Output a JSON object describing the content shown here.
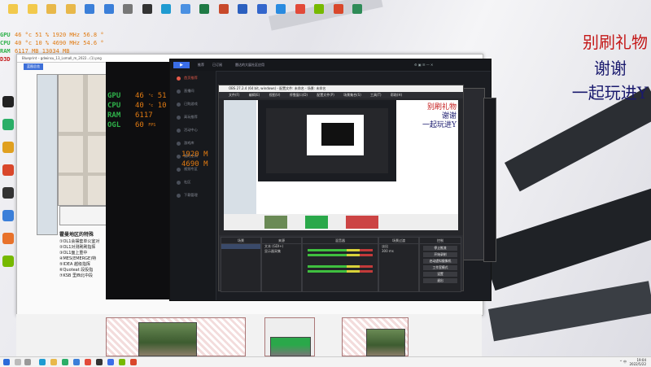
{
  "desktop": {
    "icons": [
      {
        "label": "",
        "icon": "file-icon",
        "color": "#f2c94c"
      },
      {
        "label": "",
        "icon": "file-icon",
        "color": "#f2c94c"
      },
      {
        "label": "",
        "icon": "folder-icon",
        "color": "#e8b84a"
      },
      {
        "label": "",
        "icon": "folder-icon",
        "color": "#e8b84a"
      },
      {
        "label": "",
        "icon": "app-icon",
        "color": "#3b7fd9"
      },
      {
        "label": "",
        "icon": "app-icon",
        "color": "#3b7fd9"
      },
      {
        "label": "",
        "icon": "app-icon",
        "color": "#777777"
      },
      {
        "label": "",
        "icon": "mouse-icon",
        "color": "#333333"
      },
      {
        "label": "",
        "icon": "edge-icon",
        "color": "#1f9bd1"
      },
      {
        "label": "",
        "icon": "app-icon",
        "color": "#4a90e2"
      },
      {
        "label": "",
        "icon": "excel-icon",
        "color": "#1f7a45"
      },
      {
        "label": "",
        "icon": "powerpoint-icon",
        "color": "#c8492b"
      },
      {
        "label": "",
        "icon": "word-icon",
        "color": "#2b5fbf"
      },
      {
        "label": "",
        "icon": "app-icon",
        "color": "#3366cc"
      },
      {
        "label": "",
        "icon": "shield-icon",
        "color": "#2a8be0"
      },
      {
        "label": "",
        "icon": "chrome-icon",
        "color": "#e24a3a"
      },
      {
        "label": "",
        "icon": "nvidia-icon",
        "color": "#76b900"
      },
      {
        "label": "",
        "icon": "app-icon",
        "color": "#d9472b"
      },
      {
        "label": "",
        "icon": "xbox-icon",
        "color": "#2e8b57"
      }
    ],
    "left_icons": [
      {
        "icon": "qq-icon",
        "color": "#222222"
      },
      {
        "icon": "wechat-icon",
        "color": "#2aae67"
      },
      {
        "icon": "app-icon",
        "color": "#e0a020"
      },
      {
        "icon": "app-icon",
        "color": "#d9472b"
      },
      {
        "icon": "app-icon",
        "color": "#333333"
      },
      {
        "icon": "app-icon",
        "color": "#3b7fd9"
      },
      {
        "icon": "app-icon",
        "color": "#e8722b"
      },
      {
        "icon": "app-icon",
        "color": "#76b900"
      }
    ],
    "banner_text": [
      "别刷礼物",
      "谢谢",
      "一起玩进Y"
    ],
    "osd_small": [
      {
        "key": "GPU",
        "value": "46 °c   51 %  1920 MHz  56.8 °"
      },
      {
        "key": "CPU",
        "value": "40 °c   10 %  4690 MHz  54.6 °"
      },
      {
        "key": "RAM",
        "value": "6117 MB   13034 MB"
      },
      {
        "key": "D3D",
        "value": ""
      }
    ]
  },
  "blueprint_window": {
    "title": "Blueprint – gdwinsu_13_Lsmall_m_2022...(1).png",
    "tab": "蓝图总览",
    "legend_title": "霍曼地区的特殊",
    "legend_items": [
      "①OL1会摆套单公室对",
      "②OL1对测刷刷指挥",
      "③OL1面上重中",
      "④MES(EMERGE)特",
      "⑤IDEA 越级指挥",
      "⑥Quoteat 段投指",
      "⑦KSB 里西北中段"
    ]
  },
  "metrics_overlay": {
    "rows": [
      {
        "key": "GPU",
        "value": "46",
        "unit": "°c",
        "v2": "51",
        "u2": "%"
      },
      {
        "key": "CPU",
        "value": "40",
        "unit": "°c",
        "v2": "10",
        "u2": "%"
      },
      {
        "key": "RAM",
        "value": "6117",
        "unit": "MB",
        "v2": "13034",
        "u2": "MB"
      },
      {
        "key": "OGL",
        "value": "60",
        "unit": "FPS",
        "v2": "",
        "u2": ""
      }
    ]
  },
  "launcher": {
    "title_a": "推荐",
    "title_b": "已订阅",
    "title_c": "雷达的大展社区应用",
    "nav": [
      "首页推荐",
      "直播间",
      "已购游戏",
      "高玩推荐",
      "活动中心",
      "游戏库",
      "我的空间",
      "视频专区",
      "社区",
      "下载管理"
    ],
    "metrics": [
      "1920 M",
      "4690 M"
    ]
  },
  "obs": {
    "title": "OBS 27.2.4 (64 bit, windows) - 配置文件: 未命名 - 场景: 未命名",
    "menu": [
      "文件(F)",
      "编辑(E)",
      "视图(V)",
      "停靠窗口(D)",
      "配置文件(P)",
      "场景集合(S)",
      "工具(T)",
      "帮助(H)"
    ],
    "docks": {
      "scenes": "场景",
      "sources": "来源",
      "mixer": "混音器",
      "transitions": "场景过渡",
      "controls": "控制"
    },
    "source_rows": [
      "文本 (GDI+)",
      "显示器采集"
    ],
    "controls_buttons": [
      "停止推流",
      "开始录制",
      "启动虚拟摄像机",
      "工作室模式",
      "设置",
      "退出"
    ],
    "transition_value": "淡出",
    "duration": "300 ms"
  },
  "taskbar": {
    "time": "19:04",
    "date": "2022/5/22",
    "tray_text": "^ 中"
  }
}
